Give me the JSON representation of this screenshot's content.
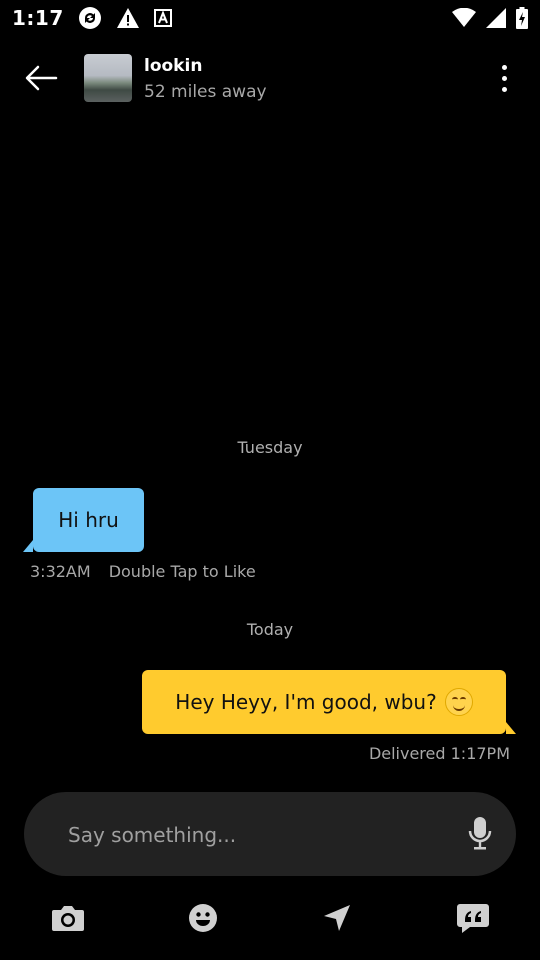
{
  "status_bar": {
    "time": "1:17",
    "icons": [
      "sync-icon",
      "warning-icon",
      "a-box-icon",
      "wifi-icon",
      "signal-icon",
      "battery-icon"
    ]
  },
  "header": {
    "contact_name": "lookin",
    "distance": "52 miles away",
    "icons": [
      "back-arrow-icon",
      "overflow-menu-icon"
    ]
  },
  "messages": [
    {
      "day": "Tuesday",
      "direction": "incoming",
      "text": "Hi hru",
      "time": "3:32AM",
      "hint": "Double Tap to Like",
      "color": "#6cc5f7"
    },
    {
      "day": "Today",
      "direction": "outgoing",
      "text": "Hey Heyy, I'm good, wbu?",
      "emoji": "smiling-face-emoji",
      "status": "Delivered 1:17PM",
      "color": "#ffcb2e"
    }
  ],
  "composer": {
    "placeholder": "Say something...",
    "icon": "microphone-icon"
  },
  "toolbar": {
    "icons": [
      "camera-icon",
      "emoji-icon",
      "location-arrow-icon",
      "quick-reply-icon"
    ]
  }
}
